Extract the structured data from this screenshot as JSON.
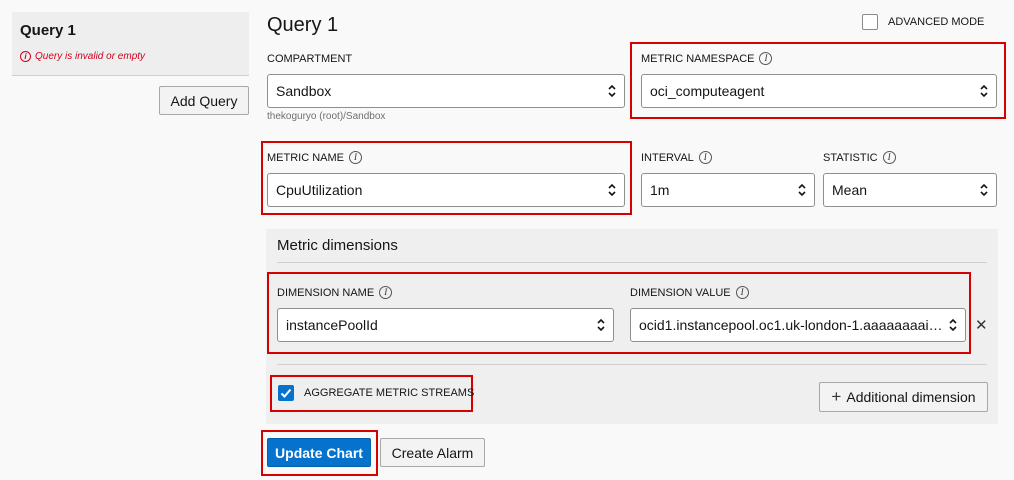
{
  "sidebar": {
    "query_title": "Query 1",
    "query_error": "Query is invalid or empty",
    "add_query_label": "Add Query"
  },
  "main": {
    "title": "Query 1",
    "advanced_mode_label": "ADVANCED MODE",
    "advanced_mode_checked": false
  },
  "compartment": {
    "label": "COMPARTMENT",
    "value": "Sandbox",
    "path": "thekoguryo (root)/Sandbox"
  },
  "metric_namespace": {
    "label": "METRIC NAMESPACE",
    "value": "oci_computeagent"
  },
  "metric_name": {
    "label": "METRIC NAME",
    "value": "CpuUtilization"
  },
  "interval": {
    "label": "INTERVAL",
    "value": "1m"
  },
  "statistic": {
    "label": "STATISTIC",
    "value": "Mean"
  },
  "dimensions": {
    "title": "Metric dimensions",
    "name_label": "DIMENSION NAME",
    "name_value": "instancePoolId",
    "value_label": "DIMENSION VALUE",
    "value_value": "ocid1.instancepool.oc1.uk-london-1.aaaaaaaai…",
    "aggregate_label": "AGGREGATE METRIC STREAMS",
    "aggregate_checked": true,
    "additional_label": "Additional dimension"
  },
  "actions": {
    "update_chart_label": "Update Chart",
    "create_alarm_label": "Create Alarm"
  },
  "colors": {
    "accent": "#0572ce",
    "error": "#d0021b",
    "highlight": "#d70000"
  }
}
